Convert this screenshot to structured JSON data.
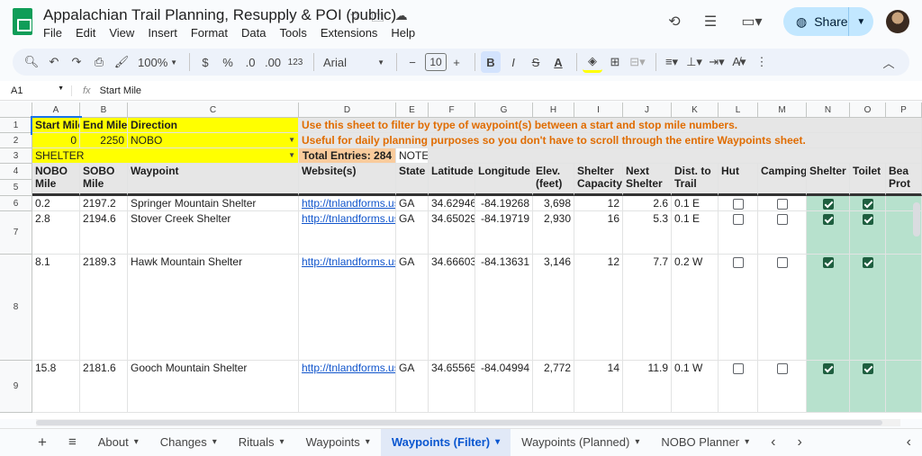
{
  "doc": {
    "title": "Appalachian Trail Planning, Resupply & POI (public)"
  },
  "menu": [
    "File",
    "Edit",
    "View",
    "Insert",
    "Format",
    "Data",
    "Tools",
    "Extensions",
    "Help"
  ],
  "share": {
    "label": "Share"
  },
  "toolbar": {
    "zoom": "100%",
    "currency": "$",
    "percent": "%",
    "dec_dec": ".0",
    "dec_inc": ".00",
    "numfmt": "123",
    "font": "Arial",
    "font_size": "10",
    "bold": "B",
    "italic": "I"
  },
  "formula": {
    "namebox": "A1",
    "fx": "fx",
    "content": "Start Mile"
  },
  "columns": [
    "A",
    "B",
    "C",
    "D",
    "E",
    "F",
    "G",
    "H",
    "I",
    "J",
    "K",
    "L",
    "M",
    "N",
    "O",
    "P",
    ""
  ],
  "rows": [
    "1",
    "2",
    "3",
    "4",
    "5",
    "6",
    "7",
    "8",
    "9"
  ],
  "filter": {
    "h_start": "Start Mile",
    "h_end": "End Mile",
    "h_dir": "Direction",
    "start": "0",
    "end": "2250",
    "direction": "NOBO",
    "type": "SHELTER",
    "total": "Total Entries: 284",
    "notes": "NOTES",
    "info1": "Use this sheet to filter by type of waypoint(s) between a start and stop mile numbers.",
    "info2": "Useful for daily planning purposes so you don't have to scroll through the entire Waypoints sheet."
  },
  "headers": {
    "nobo": "NOBO\nMile",
    "sobo": "SOBO\nMile",
    "waypoint": "Waypoint",
    "website": "Website(s)",
    "state": "State",
    "lat": "Latitude",
    "lon": "Longitude",
    "elev": "Elev.\n(feet)",
    "cap": "Shelter\nCapacity",
    "next": "Next\nShelter",
    "dist": "Dist. to\nTrail",
    "hut": "Hut",
    "camping": "Camping",
    "shelter": "Shelter",
    "toilet": "Toilet",
    "bear": "Bea\nProt"
  },
  "data_rows": [
    {
      "nobo": "0.2",
      "sobo": "2197.2",
      "name": "Springer Mountain Shelter",
      "url": "http://tnlandforms.us/a",
      "state": "GA",
      "lat": "34.62946",
      "lon": "-84.19268",
      "elev": "3,698",
      "cap": "12",
      "next": "2.6",
      "dist": "0.1 E",
      "hut": false,
      "camping": false,
      "shelter": true,
      "toilet": true
    },
    {
      "nobo": "2.8",
      "sobo": "2194.6",
      "name": "Stover Creek Shelter",
      "url": "http://tnlandforms.us/a",
      "state": "GA",
      "lat": "34.65029",
      "lon": "-84.19719",
      "elev": "2,930",
      "cap": "16",
      "next": "5.3",
      "dist": "0.1 E",
      "hut": false,
      "camping": false,
      "shelter": true,
      "toilet": true
    },
    {
      "nobo": "8.1",
      "sobo": "2189.3",
      "name": "Hawk Mountain Shelter",
      "url": "http://tnlandforms.us/a",
      "state": "GA",
      "lat": "34.66603",
      "lon": "-84.13631",
      "elev": "3,146",
      "cap": "12",
      "next": "7.7",
      "dist": "0.2 W",
      "hut": false,
      "camping": false,
      "shelter": true,
      "toilet": true
    },
    {
      "nobo": "15.8",
      "sobo": "2181.6",
      "name": "Gooch Mountain Shelter",
      "url": "http://tnlandforms.us/a",
      "state": "GA",
      "lat": "34.65565",
      "lon": "-84.04994",
      "elev": "2,772",
      "cap": "14",
      "next": "11.9",
      "dist": "0.1 W",
      "hut": false,
      "camping": false,
      "shelter": true,
      "toilet": true
    }
  ],
  "sheets": [
    "About",
    "Changes",
    "Rituals",
    "Waypoints",
    "Waypoints (Filter)",
    "Waypoints (Planned)",
    "NOBO Planner"
  ],
  "active_sheet": "Waypoints (Filter)",
  "colors": {
    "yellow": "#ffff00",
    "grey": "#e6e6e6",
    "green": "#b7e1cd",
    "orange": "#f9cb9c",
    "link": "#1155cc",
    "share": "#c2e7ff"
  }
}
